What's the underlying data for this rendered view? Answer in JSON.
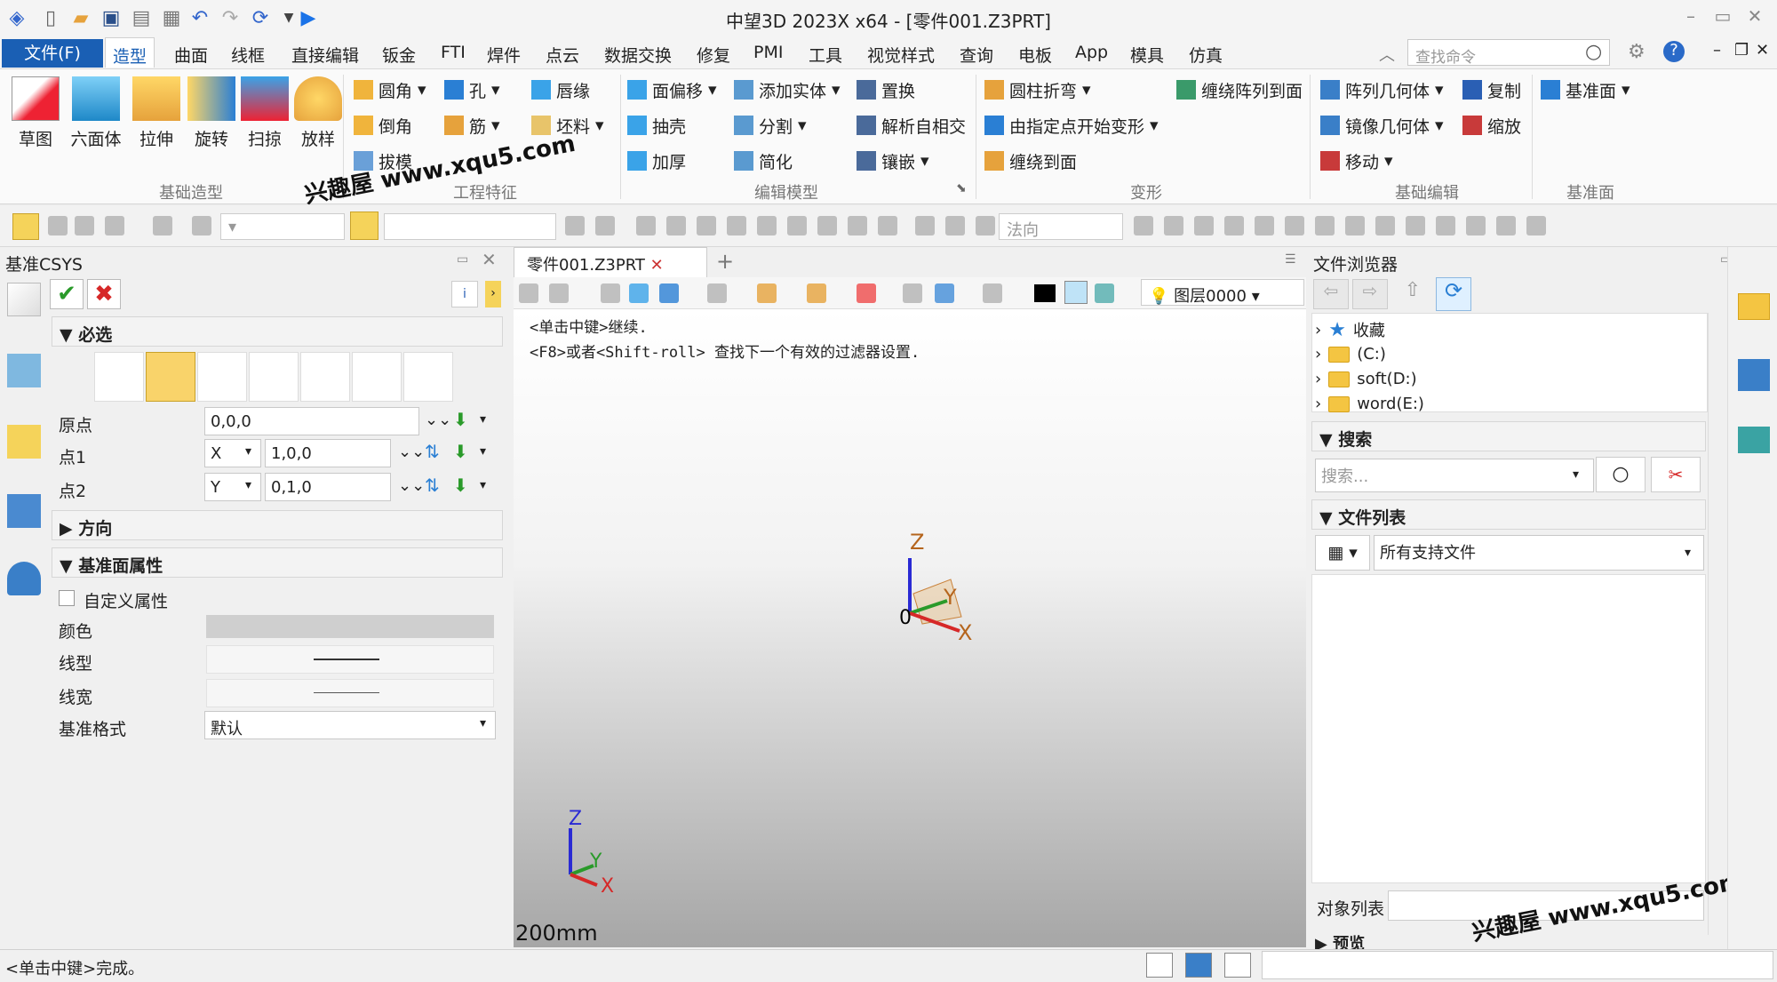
{
  "app_title": "中望3D 2023X x64 - [零件001.Z3PRT]",
  "menu": {
    "file": "文件(F)",
    "tabs": [
      "造型",
      "曲面",
      "线框",
      "直接编辑",
      "钣金",
      "FTI",
      "焊件",
      "点云",
      "数据交换",
      "修复",
      "PMI",
      "工具",
      "视觉样式",
      "查询",
      "电板",
      "App",
      "模具",
      "仿真"
    ]
  },
  "search_cmd_placeholder": "查找命令",
  "ribbon": {
    "basic": {
      "group": "基础造型",
      "items": [
        "草图",
        "六面体",
        "拉伸",
        "旋转",
        "扫掠",
        "放样"
      ]
    },
    "feature": {
      "group": "工程特征",
      "items": [
        "圆角",
        "孔",
        "唇缘",
        "倒角",
        "筋",
        "坯料",
        "拔模"
      ]
    },
    "edit": {
      "group": "编辑模型",
      "items": [
        "面偏移",
        "添加实体",
        "置换",
        "抽壳",
        "分割",
        "解析自相交",
        "加厚",
        "简化",
        "镶嵌"
      ]
    },
    "deform": {
      "group": "变形",
      "items": [
        "圆柱折弯",
        "缠绕阵列到面",
        "由指定点开始变形",
        "缠绕到面"
      ]
    },
    "basicedit": {
      "group": "基础编辑",
      "items": [
        "阵列几何体",
        "复制",
        "镜像几何体",
        "缩放",
        "移动"
      ]
    },
    "datum": {
      "group": "基准面",
      "items": [
        "基准面"
      ]
    }
  },
  "toolbar2": {
    "filter_value": "法向"
  },
  "left_panel": {
    "title": "基准CSYS",
    "required": "必选",
    "fields": [
      {
        "label": "原点",
        "axis": "",
        "value": "0,0,0"
      },
      {
        "label": "点1",
        "axis": "X",
        "value": "1,0,0"
      },
      {
        "label": "点2",
        "axis": "Y",
        "value": "0,1,0"
      }
    ],
    "direction": "方向",
    "plane_props": "基准面属性",
    "custom_props": "自定义属性",
    "color": "颜色",
    "line_type": "线型",
    "line_width": "线宽",
    "datum_format": "基准格式",
    "datum_format_value": "默认"
  },
  "viewport": {
    "tab": "零件001.Z3PRT",
    "layer": "图层0000",
    "hint1": "<单击中键>继续.",
    "hint2": "<F8>或者<Shift-roll> 查找下一个有效的过滤器设置.",
    "scale": "200mm",
    "axes": {
      "z": "Z",
      "y": "Y",
      "x": "X",
      "o": "0"
    }
  },
  "right_panel": {
    "title": "文件浏览器",
    "tree": [
      "收藏",
      "(C:)",
      "soft(D:)",
      "word(E:)"
    ],
    "search_title": "搜索",
    "search_placeholder": "搜索...",
    "file_list": "文件列表",
    "file_filter": "所有支持文件",
    "object_list": "对象列表",
    "preview": "预览"
  },
  "status": "<单击中键>完成。",
  "watermark": "兴趣屋 www.xqu5.com",
  "colors": {
    "accent": "#1a5fb4"
  }
}
